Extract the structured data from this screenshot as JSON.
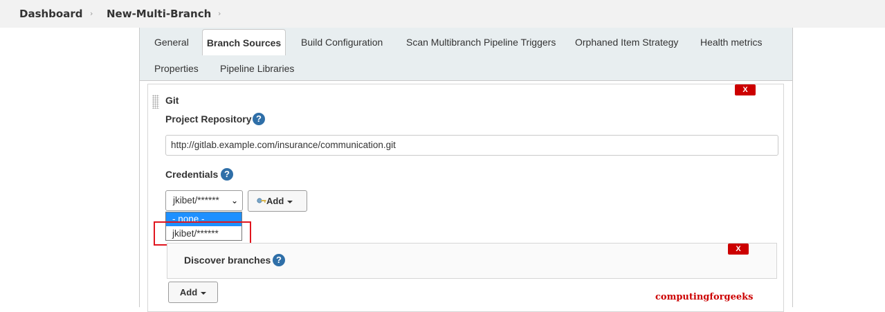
{
  "breadcrumb": {
    "items": [
      "Dashboard",
      "New-Multi-Branch"
    ]
  },
  "tabs": {
    "row1": [
      "General",
      "Branch Sources",
      "Build Configuration",
      "Scan Multibranch Pipeline Triggers",
      "Orphaned Item Strategy",
      "Health metrics"
    ],
    "row2": [
      "Properties",
      "Pipeline Libraries"
    ],
    "active": "Branch Sources"
  },
  "git": {
    "title": "Git",
    "delete_label": "X",
    "project_repository_label": "Project Repository",
    "project_repository_value": "http://gitlab.example.com/insurance/communication.git",
    "help_glyph": "?",
    "credentials_label": "Credentials",
    "credentials_selected": "jkibet/******",
    "credentials_options": [
      "- none -",
      "jkibet/******"
    ],
    "add_button_label": "Add",
    "add_button_icon": "key-icon"
  },
  "behaviours": {
    "discover_branches_label": "Discover branches",
    "delete_label": "X",
    "add_button_label": "Add"
  },
  "watermark": "computingforgeeks",
  "colors": {
    "active_option": "#1e90ff",
    "delete_button": "#cc0000",
    "help_icon": "#2f6fa8",
    "highlight_box": "#e0151e",
    "tab_bar": "#e8eef0"
  }
}
